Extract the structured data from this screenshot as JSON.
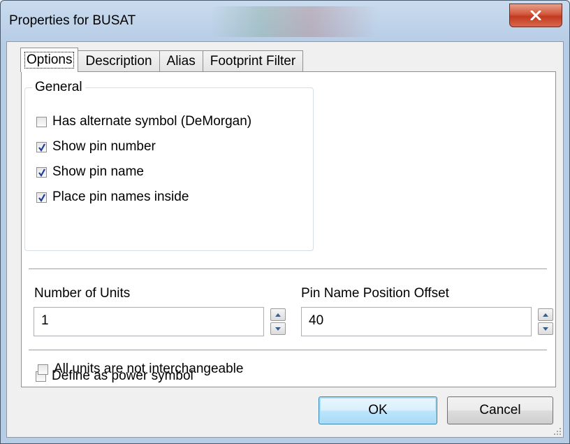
{
  "window": {
    "title": "Properties for BUSAT"
  },
  "tabs": [
    {
      "label": "Options",
      "active": true
    },
    {
      "label": "Description",
      "active": false
    },
    {
      "label": "Alias",
      "active": false
    },
    {
      "label": "Footprint Filter",
      "active": false
    }
  ],
  "general": {
    "label": "General",
    "options": [
      {
        "label": "Has alternate symbol (DeMorgan)",
        "checked": false
      },
      {
        "label": "Show pin number",
        "checked": true
      },
      {
        "label": "Show pin name",
        "checked": true
      },
      {
        "label": "Place pin names inside",
        "checked": true
      }
    ]
  },
  "units": {
    "label": "Number of Units",
    "value": "1"
  },
  "offset": {
    "label": "Pin Name Position Offset",
    "value": "40"
  },
  "power": {
    "label": "Define as power symbol",
    "checked": false
  },
  "interchange": {
    "label": "All units are not interchangeable",
    "checked": false
  },
  "buttons": {
    "ok": "OK",
    "cancel": "Cancel"
  },
  "colors": {
    "close_button": "#c9452a",
    "title_bar": "#b7cde6",
    "default_button": "#bee6fd"
  }
}
